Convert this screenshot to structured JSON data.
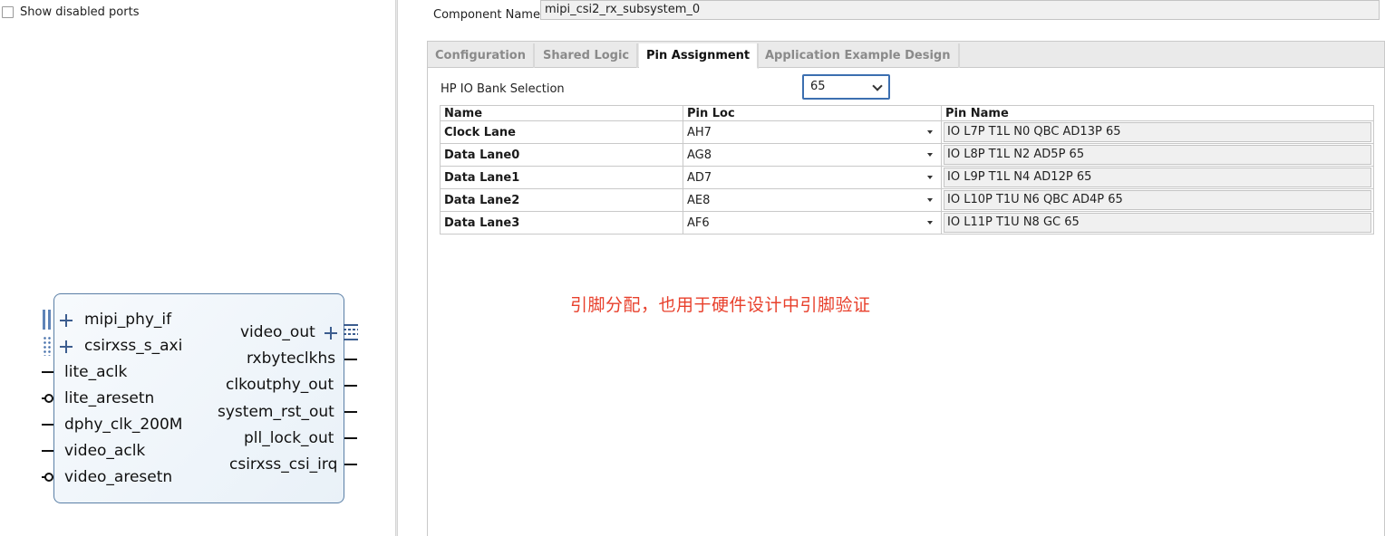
{
  "left": {
    "show_disabled_ports_label": "Show disabled ports",
    "ip_block": {
      "left_ports": [
        {
          "label": "mipi_phy_if",
          "kind": "bus-in"
        },
        {
          "label": "csirxss_s_axi",
          "kind": "bus-in"
        },
        {
          "label": "lite_aclk",
          "kind": "wire"
        },
        {
          "label": "lite_aresetn",
          "kind": "wire-inverted"
        },
        {
          "label": "dphy_clk_200M",
          "kind": "wire"
        },
        {
          "label": "video_aclk",
          "kind": "wire"
        },
        {
          "label": "video_aresetn",
          "kind": "wire-inverted"
        }
      ],
      "right_ports": [
        {
          "label": "video_out",
          "kind": "bus-out"
        },
        {
          "label": "rxbyteclkhs",
          "kind": "wire"
        },
        {
          "label": "clkoutphy_out",
          "kind": "wire"
        },
        {
          "label": "system_rst_out",
          "kind": "wire"
        },
        {
          "label": "pll_lock_out",
          "kind": "wire"
        },
        {
          "label": "csirxss_csi_irq",
          "kind": "wire"
        }
      ]
    }
  },
  "right": {
    "component_name_label": "Component Name",
    "component_name_value": "mipi_csi2_rx_subsystem_0",
    "tabs": [
      {
        "label": "Configuration",
        "active": false
      },
      {
        "label": "Shared Logic",
        "active": false
      },
      {
        "label": "Pin Assignment",
        "active": true
      },
      {
        "label": "Application Example Design",
        "active": false
      }
    ],
    "hp_bank_label": "HP IO Bank Selection",
    "hp_bank_value": "65",
    "table": {
      "headers": [
        "Name",
        "Pin Loc",
        "Pin Name"
      ],
      "rows": [
        {
          "name": "Clock Lane",
          "loc": "AH7",
          "pin": "IO L7P T1L N0 QBC AD13P 65"
        },
        {
          "name": "Data Lane0",
          "loc": "AG8",
          "pin": "IO L8P T1L N2 AD5P 65"
        },
        {
          "name": "Data Lane1",
          "loc": "AD7",
          "pin": "IO L9P T1L N4 AD12P 65"
        },
        {
          "name": "Data Lane2",
          "loc": "AE8",
          "pin": "IO L10P T1U N6 QBC AD4P 65"
        },
        {
          "name": "Data Lane3",
          "loc": "AF6",
          "pin": "IO L11P T1U N8 GC 65"
        }
      ]
    },
    "annotation": "引脚分配，也用于硬件设计中引脚验证"
  },
  "colors": {
    "accent_blue": "#3c6fb0",
    "annotation_red": "#e8402c",
    "block_border": "#5a7fa6"
  }
}
